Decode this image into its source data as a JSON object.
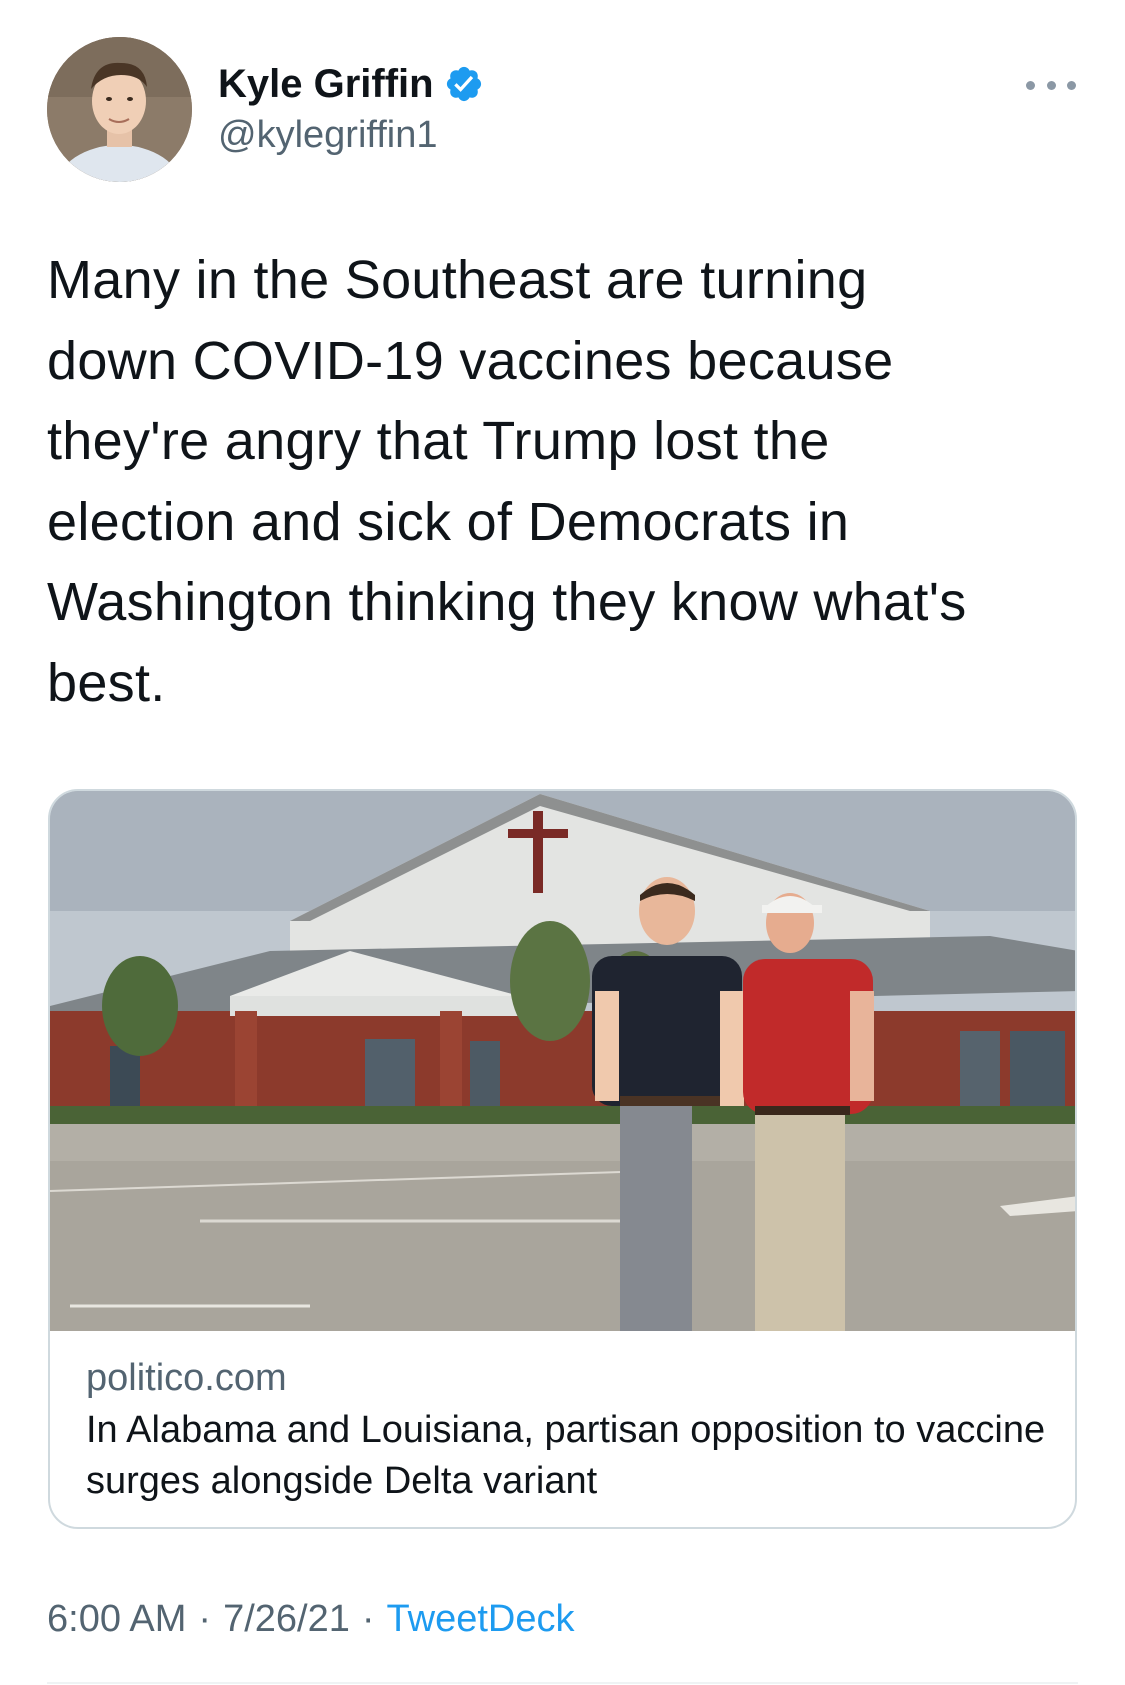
{
  "author": {
    "display_name": "Kyle Griffin",
    "handle": "@kylegriffin1",
    "verified_icon": "verified-badge-icon",
    "avatar_icon": "avatar"
  },
  "more_icon": "more-options-icon",
  "tweet": {
    "text": "Many in the Southeast are turning\ndown COVID-19 vaccines because\nthey're angry that Trump lost the\nelection and sick of Democrats in\nWashington thinking they know what's\nbest."
  },
  "card": {
    "domain": "politico.com",
    "title": "In Alabama and Louisiana, partisan opposition to vaccine surges alongside Delta variant"
  },
  "meta": {
    "time": "6:00 AM",
    "separator": "·",
    "date": "7/26/21",
    "source": "TweetDeck"
  },
  "colors": {
    "accent": "#1d9bf0",
    "secondary_text": "#536471",
    "card_border": "#cfd9de"
  }
}
